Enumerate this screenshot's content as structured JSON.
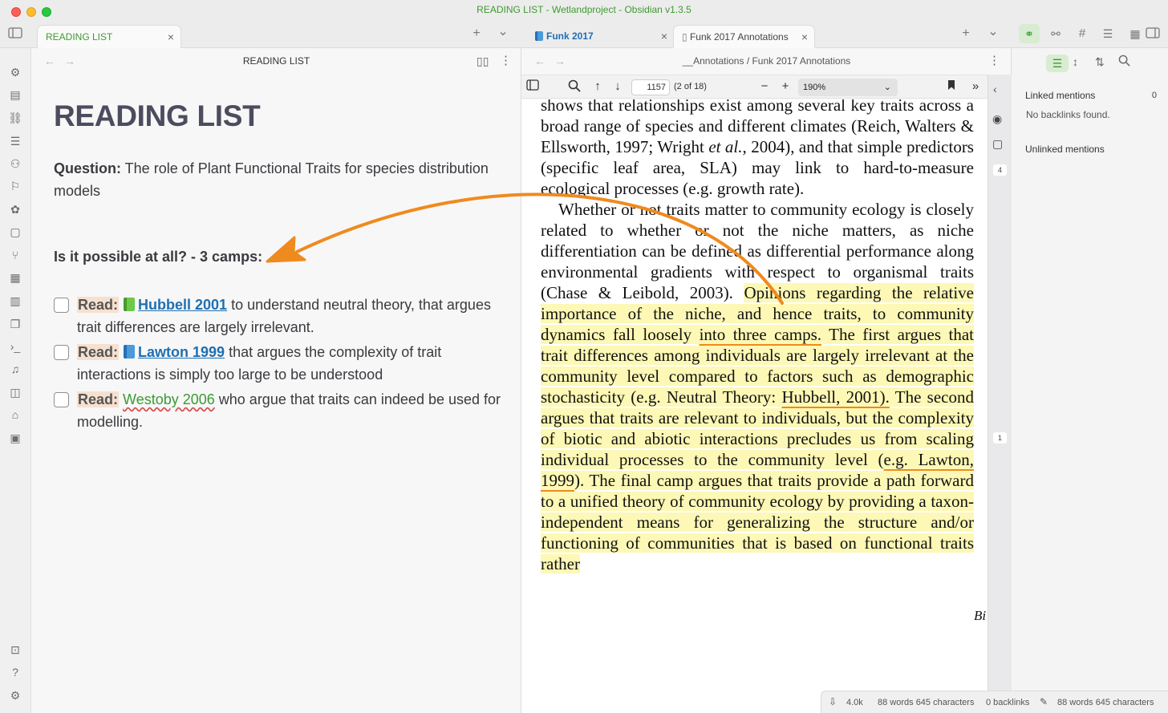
{
  "window": {
    "title": "READING LIST - Wetlandproject - Obsidian v1.3.5"
  },
  "left_tabs": {
    "active_tab": "READING LIST",
    "close": "×",
    "new_tab": "+",
    "menu": "⌄"
  },
  "right_tabs": {
    "tab1": "Funk 2017",
    "tab2": "Funk 2017 Annotations",
    "close": "×",
    "new_tab": "+",
    "menu": "⌄"
  },
  "left_pane": {
    "view_title": "READING LIST",
    "back": "←",
    "forward": "→",
    "note": {
      "title": "READING LIST",
      "question_label": "Question:",
      "question_text": " The role of Plant Functional Traits for species distribution models",
      "subheading": "Is it possible at all? - 3 camps:",
      "tasks": [
        {
          "label": "Read:",
          "link": "Hubbell 2001",
          "rest": " to understand neutral theory,  that argues trait differences are largely irrelevant."
        },
        {
          "label": "Read:",
          "link": "Lawton 1999",
          "rest": " that argues the complexity of trait interactions is simply too large to be understood"
        },
        {
          "label": "Read:",
          "link": "Westoby 2006",
          "rest": " who argue that traits can indeed be used for modelling."
        }
      ]
    }
  },
  "right_pane": {
    "breadcrumb": "__Annotations / Funk 2017 Annotations",
    "pdf_toolbar": {
      "page_number": "1157",
      "page_count": "(2 of 18)",
      "zoom": "190%"
    },
    "pdf_lines": {
      "l1": "shows that relationships exist among several key traits across a broad range of species and different climates (Reich, Walters & Ellsworth, 1997; Wright ",
      "l1_etal": "et al.",
      "l1b": ", 2004), and that simple predictors (specific leaf area, SLA) may link to hard-to-measure ecological processes (e.g. growth rate).",
      "p2a": "Whether or not traits matter to community ecology is closely related to whether or not the niche matters, as niche differentiation can be defined as differential performance along environmental gradients with respect to organismal traits (Chase & Leibold, 2003). ",
      "p2b": "Opinions regarding the relative importance of the niche, and hence traits, to community dynamics fall loosely ",
      "p2_u1": "into three camps.",
      "p2c": " The first argues that trait differences among individuals are largely irrelevant at the community level compared to factors such as demographic stochasticity (e.g. Neutral Theory: ",
      "p2_u2": "Hubbell, 2001).",
      "p2d": " The second argues that traits are relevant to individuals, but the complexity of biotic and abiotic interactions precludes us from scaling individual processes to the community level (",
      "p2_u3": "e.g. Lawton, 1999",
      "p2e": "). The final camp argues that traits provide a path forward to a unified theory of community ecology by providing a taxon-independent means for generalizing the structure and/or functioning of communities that is based on functional traits rather"
    },
    "page_footer": "Bi",
    "sidecol_badges": {
      "a": "4",
      "b": "1"
    }
  },
  "right_sidebar": {
    "linked_mentions": "Linked mentions",
    "linked_count": "0",
    "no_backlinks": "No backlinks found.",
    "unlinked_mentions": "Unlinked mentions"
  },
  "status_bar": {
    "size": "4.0k",
    "counts1": "88 words 645 characters",
    "backlinks": "0 backlinks",
    "counts2": "88 words  645 characters"
  },
  "colors": {
    "accent": "#3f9a31",
    "link": "#1f6fb3",
    "highlight": "#fdf8b5",
    "annotation_arrow": "#ef8a1e"
  }
}
